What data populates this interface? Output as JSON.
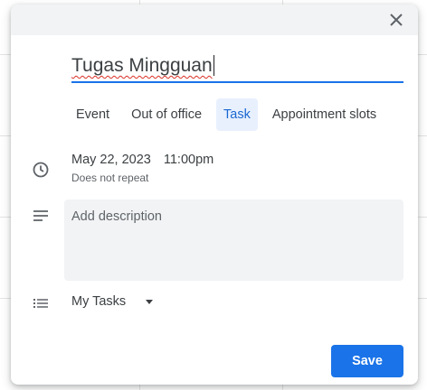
{
  "dialog": {
    "title_value": "Tugas Mingguan",
    "tabs": [
      {
        "label": "Event"
      },
      {
        "label": "Out of office"
      },
      {
        "label": "Task"
      },
      {
        "label": "Appointment slots"
      }
    ],
    "active_tab": "Task",
    "date": "May 22, 2023",
    "time": "11:00pm",
    "repeat": "Does not repeat",
    "description_placeholder": "Add description",
    "task_list": "My Tasks",
    "save_label": "Save"
  },
  "icons": {
    "close": "close-icon",
    "time": "clock-icon",
    "description": "notes-icon",
    "list": "list-icon",
    "dropdown": "arrow-drop-down-icon"
  },
  "colors": {
    "accent": "#1a73e8",
    "active_tab_bg": "#e8f0fe",
    "field_bg": "#f1f3f4",
    "header_bg": "#f1f3f4",
    "spell_underline": "#d93025"
  }
}
